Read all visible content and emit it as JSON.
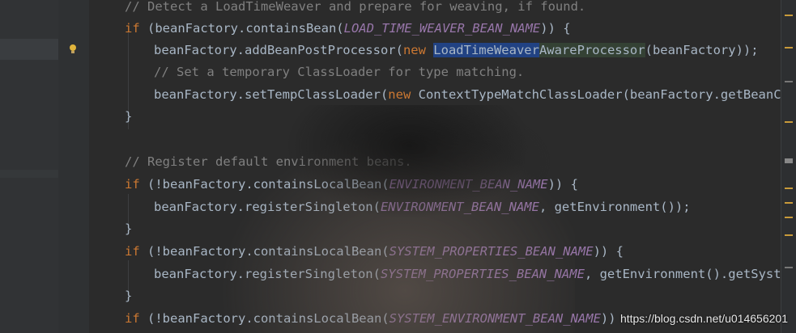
{
  "code_lines": {
    "l1": {
      "comment": "// Detect a LoadTimeWeaver and prepare for weaving, if found."
    },
    "l2": {
      "kw": "if",
      "p1": " (beanFactory.containsBean(",
      "const": "LOAD_TIME_WEAVER_BEAN_NAME",
      "p2": ")) {"
    },
    "l3": {
      "p1": "beanFactory.addBeanPostProcessor(",
      "kw": "new",
      "sel": "LoadTimeWeaver",
      "green": "AwareProcessor",
      "p2": "(beanFactory));"
    },
    "l4": {
      "comment": "// Set a temporary ClassLoader for type matching."
    },
    "l5": {
      "p1": "beanFactory.setTempClassLoader(",
      "kw": "new",
      "p2": " ContextTypeMatchClassLoader(beanFactory.getBeanCla"
    },
    "l6": {
      "p1": "}"
    },
    "l7": {
      "comment": "// Register default environment beans."
    },
    "l8": {
      "kw": "if",
      "p1": " (!beanFactory.containsLocalBean(",
      "const": "ENVIRONMENT_BEAN_NAME",
      "p2": ")) {"
    },
    "l9": {
      "p1": "beanFactory.registerSingleton(",
      "const": "ENVIRONMENT_BEAN_NAME",
      "p2": ", getEnvironment());"
    },
    "l10": {
      "p1": "}"
    },
    "l11": {
      "kw": "if",
      "p1": " (!beanFactory.containsLocalBean(",
      "const": "SYSTEM_PROPERTIES_BEAN_NAME",
      "p2": ")) {"
    },
    "l12": {
      "p1": "beanFactory.registerSingleton(",
      "const": "SYSTEM_PROPERTIES_BEAN_NAME",
      "p2": ", getEnvironment().getSystem"
    },
    "l13": {
      "p1": "}"
    },
    "l14": {
      "kw": "if",
      "p1": " (!beanFactory.containsLocalBean(",
      "const": "SYSTEM_ENVIRONMENT_BEAN_NAME",
      "p2": "))"
    }
  },
  "watermark": "https://blog.csdn.net/u014656201",
  "colors": {
    "background": "#2b2b2b",
    "keyword": "#cc7832",
    "constant": "#9876aa",
    "comment": "#808080",
    "text": "#a9b7c6",
    "selection": "#214283"
  },
  "icons": {
    "intention": "lightbulb-icon"
  }
}
